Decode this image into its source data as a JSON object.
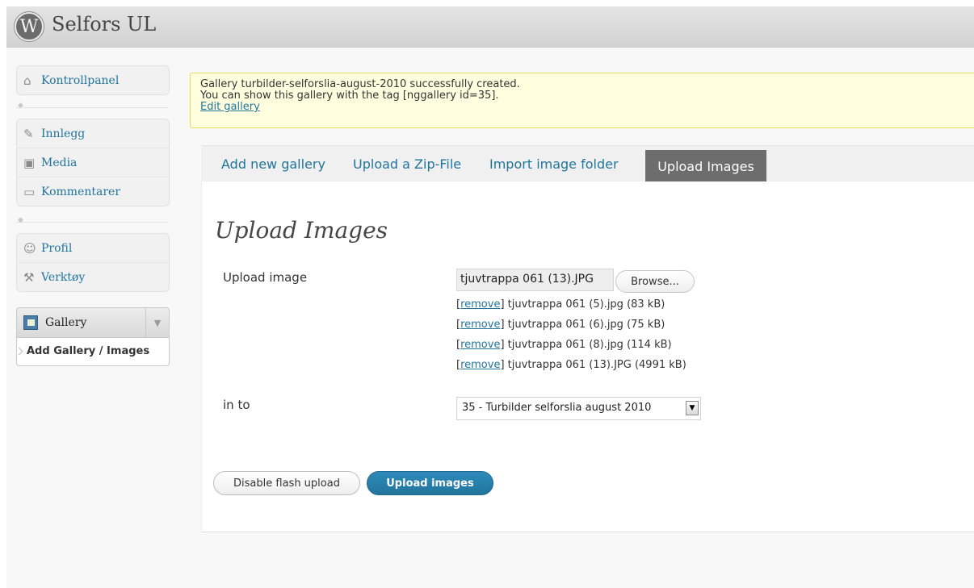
{
  "header": {
    "site_title": "Selfors UL",
    "logo_letter": "W"
  },
  "sidebar": {
    "group1": [
      {
        "label": "Kontrollpanel",
        "icon": "home-icon"
      }
    ],
    "group2": [
      {
        "label": "Innlegg",
        "icon": "pin-icon"
      },
      {
        "label": "Media",
        "icon": "media-icon"
      },
      {
        "label": "Kommentarer",
        "icon": "comments-icon"
      }
    ],
    "group3": [
      {
        "label": "Profil",
        "icon": "users-icon"
      },
      {
        "label": "Verktøy",
        "icon": "tools-icon"
      }
    ],
    "gallery": {
      "label": "Gallery",
      "submenu_label": "Add Gallery / Images"
    }
  },
  "notice": {
    "line1": "Gallery turbilder-selforslia-august-2010 successfully created.",
    "line2": "You can show this gallery with the tag [nggallery id=35].",
    "link": "Edit gallery"
  },
  "tabs": {
    "add_new_gallery": "Add new gallery",
    "upload_zip": "Upload a Zip-File",
    "import_folder": "Import image folder",
    "upload_images": "Upload Images"
  },
  "form": {
    "heading": "Upload Images",
    "upload_label": "Upload image",
    "file_value": "tjuvtrappa 061 (13).JPG",
    "browse_label": "Browse...",
    "remove_label": "remove",
    "files": [
      "tjuvtrappa 061 (5).jpg (83 kB)",
      "tjuvtrappa 061 (6).jpg (75 kB)",
      "tjuvtrappa 061 (8).jpg (114 kB)",
      "tjuvtrappa 061 (13).JPG (4991 kB)"
    ],
    "into_label": "in to",
    "gallery_select": "35 - Turbilder selforslia august 2010",
    "disable_flash_label": "Disable flash upload",
    "upload_button_label": "Upload images"
  }
}
